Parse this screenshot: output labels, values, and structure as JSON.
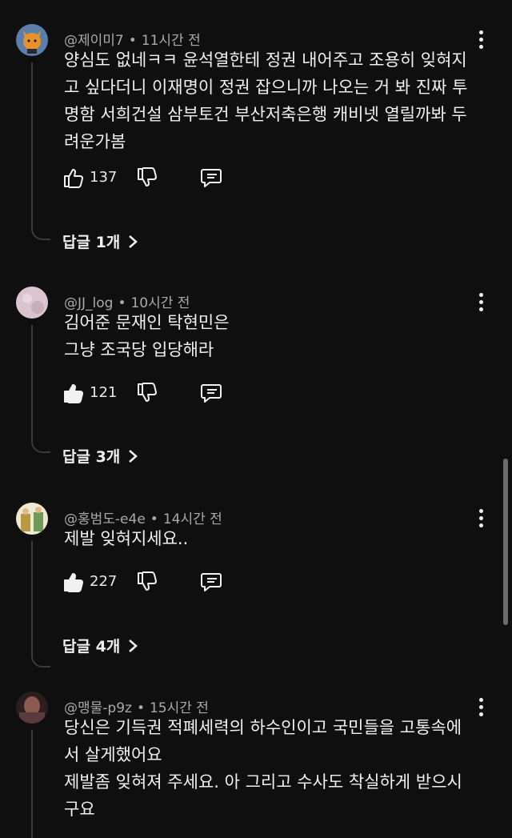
{
  "comments": [
    {
      "author": "@제이미7",
      "time": "11시간 전",
      "lines": [
        "양심도 없네ㅋㅋ 윤석열한테 정권 내어주고 조용히 잊혀지",
        "고 싶다더니 이재명이 정권 잡으니까 나오는 거 봐 진짜 투",
        "명함 서희건설 삼부토건 부산저축은행 캐비넷 열릴까봐 두",
        "려운가봄"
      ],
      "likes": "137",
      "replies": "답글 1개",
      "liked": false
    },
    {
      "author": "@JJ_log",
      "time": "10시간 전",
      "lines": [
        "김어준 문재인 탁현민은",
        "그냥 조국당 입당해라"
      ],
      "likes": "121",
      "replies": "답글 3개",
      "liked": true
    },
    {
      "author": "@홍범도-e4e",
      "time": "14시간 전",
      "lines": [
        "제발 잊혀지세요.."
      ],
      "likes": "227",
      "replies": "답글 4개",
      "liked": true
    },
    {
      "author": "@맹물-p9z",
      "time": "15시간 전",
      "lines": [
        "당신은 기득권 적폐세력의 하수인이고 국민들을 고통속에",
        "서 살게했어요",
        "제발좀 잊혀져 주세요. 아 그리고 수사도 착실하게 받으시",
        "구요"
      ]
    }
  ],
  "colors": {
    "background": "#0f0f0f",
    "text": "#f1f1f1",
    "meta": "#aaaaaa",
    "thread": "#3a3a3a"
  }
}
